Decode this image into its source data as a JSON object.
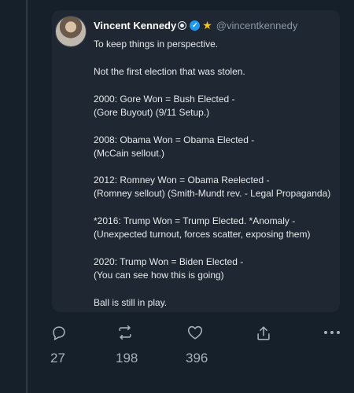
{
  "author": {
    "name": "Vincent Kennedy",
    "handle": "@vincentkennedy"
  },
  "post": {
    "paragraphs": [
      [
        "To keep things in perspective."
      ],
      [
        "Not the first election that was stolen."
      ],
      [
        "2000: Gore Won = Bush Elected -",
        "(Gore Buyout) (9/11 Setup.)"
      ],
      [
        "2008: Obama Won = Obama Elected -",
        "(McCain sellout.)"
      ],
      [
        "2012: Romney Won = Obama Reelected -",
        "(Romney sellout) (Smith-Mundt rev. - Legal Propaganda)"
      ],
      [
        "*2016: Trump Won = Trump Elected. *Anomaly -",
        "(Unexpected turnout, forces scatter, exposing them)"
      ],
      [
        "2020: Trump Won = Biden Elected -",
        "(You can see how this is going)"
      ],
      [
        "Ball is still in play."
      ]
    ]
  },
  "actions": {
    "replies": "27",
    "reposts": "198",
    "likes": "396"
  },
  "colors": {
    "background": "#15202b",
    "card": "#1e2732",
    "verified": "#1d9bf0",
    "star": "#f5c518",
    "muted": "#8b98a5"
  }
}
